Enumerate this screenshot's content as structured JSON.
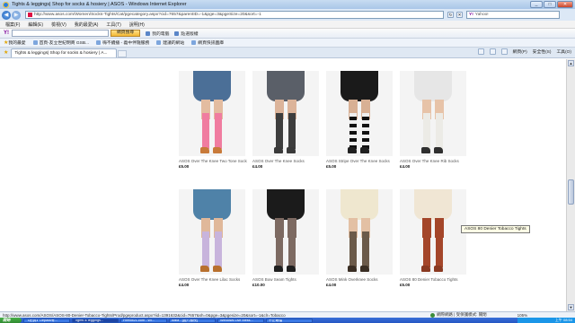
{
  "window": {
    "title": "Tights & leggings| Shop for socks & hosiery | ASOS - Windows Internet Explorer",
    "min": "_",
    "max": "□",
    "close": "✕"
  },
  "address": {
    "url": "http://www.asos.com/Women/Socks-Tights/Cat/pgecategory.aspx?cid=7657&parentID=-1&pge=3&pgeSize=20&sort=-1",
    "search_value": "Yahoo!"
  },
  "menu": [
    "檔案(F)",
    "編輯(E)",
    "檢視(V)",
    "我的最愛(A)",
    "工具(T)",
    "說明(H)"
  ],
  "toolbar": {
    "brand": "Y!",
    "search_button": "網頁搜尋",
    "items": [
      "我的電腦",
      "點選版權"
    ]
  },
  "links": {
    "favorites_label": "我的最愛",
    "items": [
      "首頁-友立世紀明商 GSB...",
      "嗨不續播 - 義中伴隨服務",
      "建議的網站",
      "網頁快訊圖庫"
    ]
  },
  "tab": {
    "label": "Tights & leggings| Shop for socks & hosiery | A..."
  },
  "commands": [
    "網頁(P)",
    "安全性(S)",
    "工具(O)"
  ],
  "products": [
    {
      "name": "ASOS Over The Knee Two Tone Sock",
      "price": "£5.00",
      "colors": {
        "garment": "#4b6f97",
        "legs": "#f07ca0",
        "shoe": "#c87a3a",
        "thigh": "#e3bca0"
      }
    },
    {
      "name": "ASOS Over The Knee Socks",
      "price": "£4.00",
      "colors": {
        "garment": "#5a5f68",
        "legs": "#3d3d3d",
        "shoe": "#3a3a3a",
        "thigh": "#dcb49a"
      }
    },
    {
      "name": "ASOS Stripe Over The Knee Socks",
      "price": "£5.00",
      "colors": {
        "garment": "#1a1a1a",
        "legs": "#efefef",
        "shoe": "#202020",
        "thigh": "#d8b094",
        "stripes": "#111111"
      }
    },
    {
      "name": "ASOS Over The Knee Rib Socks",
      "price": "£4.00",
      "colors": {
        "garment": "#e6e6e6",
        "legs": "#ecebe6",
        "shoe": "#2f2f2f",
        "thigh": "#e7c3a8"
      }
    },
    {
      "name": "ASOS Over The Knee Lilac Socks",
      "price": "£4.00",
      "colors": {
        "garment": "#4f82a8",
        "legs": "#c8b4dc",
        "shoe": "#b8702e",
        "thigh": "#e0b89a"
      }
    },
    {
      "name": "ASOS Bow Seam Tights",
      "price": "£10.00",
      "colors": {
        "garment": "#1b1b1b",
        "legs": "#7d6a62",
        "shoe": "#1f1f1f",
        "thigh": "#7d6a62"
      }
    },
    {
      "name": "ASOS Mink Overknee Socks",
      "price": "£4.00",
      "colors": {
        "garment": "#efe7cf",
        "legs": "#6b5a4a",
        "shoe": "#3a2e24",
        "thigh": "#e3c0a4"
      }
    },
    {
      "name": "ASOS 80 Denier Tobacco Tights",
      "price": "£5.00",
      "colors": {
        "garment": "#f0e6d4",
        "legs": "#a4462a",
        "shoe": "#8a3a22",
        "thigh": "#a4462a"
      }
    }
  ],
  "tooltip": "ASOS 80 Denier Tobacco Tights",
  "status": {
    "url": "http://www.asos.com/ASOS/ASOS-80-Denier-Tobacco-Tights/Prod/pgeproduct.aspx?iid=1391632&cid=7657&sh=0&pge=3&pgesize=20&sort=-1&clr=Tobacco",
    "zone": "網際網路 | 受保護模式: 關閉",
    "zoom": "105%"
  },
  "taskbar": {
    "start": "開始",
    "tasks": [
      "【拍賣】Depass有...",
      "Tights & leggings...",
      "Firefox21.com - Wi...",
      "Afilia - [圖片檢視]",
      "Windows Live Mess...",
      "不正確檔"
    ],
    "clock": "上午 08:54"
  }
}
